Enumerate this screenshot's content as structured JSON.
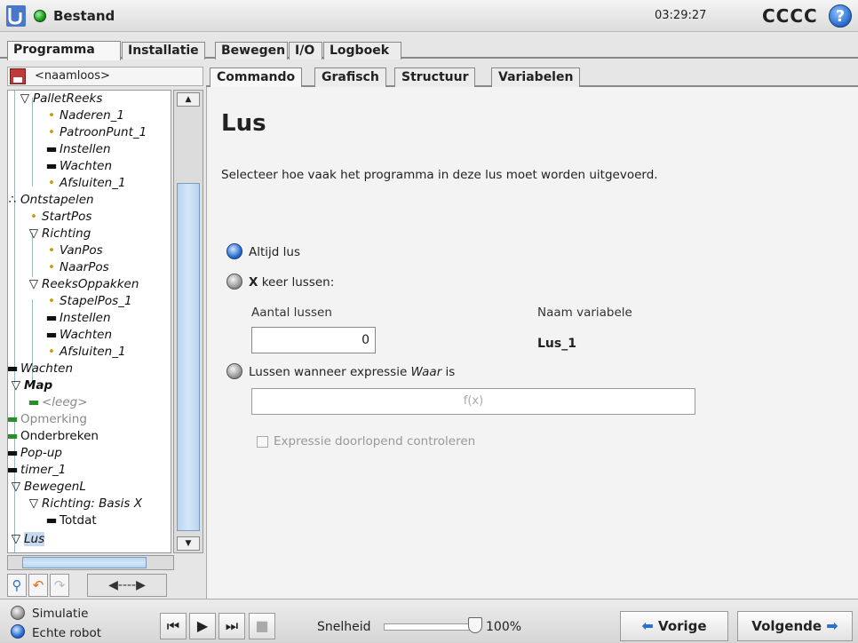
{
  "topbar": {
    "app_title": "Bestand",
    "clock": "03:29:27",
    "robot_name": "CCCC",
    "help_label": "?"
  },
  "main_tabs": [
    "Programma",
    "Installatie",
    "Bewegen",
    "I/O",
    "Logboek"
  ],
  "file": {
    "name": "<naamloos>"
  },
  "tree": {
    "nodes": [
      "PalletReeks",
      "Naderen_1",
      "PatroonPunt_1",
      "Instellen",
      "Wachten",
      "Afsluiten_1",
      "Ontstapelen",
      "StartPos",
      "Richting",
      "VanPos",
      "NaarPos",
      "ReeksOppakken",
      "StapelPos_1",
      "Instellen",
      "Wachten",
      "Afsluiten_1",
      "Wachten",
      "Map",
      "<leeg>",
      "Opmerking",
      "Onderbreken",
      "Pop-up",
      "timer_1",
      "BewegenL",
      "Richting: Basis X",
      "Totdat",
      "Lus"
    ]
  },
  "tree_tools": {
    "arrows": "◀----▶"
  },
  "right_tabs": [
    "Commando",
    "Grafisch",
    "Structuur",
    "Variabelen"
  ],
  "command": {
    "title": "Lus",
    "description": "Selecteer hoe vaak het programma in deze lus moet worden uitgevoerd.",
    "option_always": "Altijd lus",
    "option_times_x": "X",
    "option_times_rest": " keer lussen:",
    "count_label": "Aantal lussen",
    "count_value": "0",
    "varname_label": "Naam variabele",
    "varname_value": "Lus_1",
    "option_expr_pre": "Lussen wanneer expressie ",
    "option_expr_italic": "Waar",
    "option_expr_post": " is",
    "expr_placeholder": "f(x)",
    "check_label": "Expressie doorlopend controleren"
  },
  "bottom": {
    "sim_label": "Simulatie",
    "real_label": "Echte robot",
    "speed_label": "Snelheid",
    "speed_value": "100%",
    "speed_fraction": 1.0,
    "prev_label": "Vorige",
    "next_label": "Volgende"
  },
  "colors": {
    "accent": "#2c6fd0",
    "status_green": "#1c9a1c",
    "logo_blue": "#4a78c8"
  }
}
